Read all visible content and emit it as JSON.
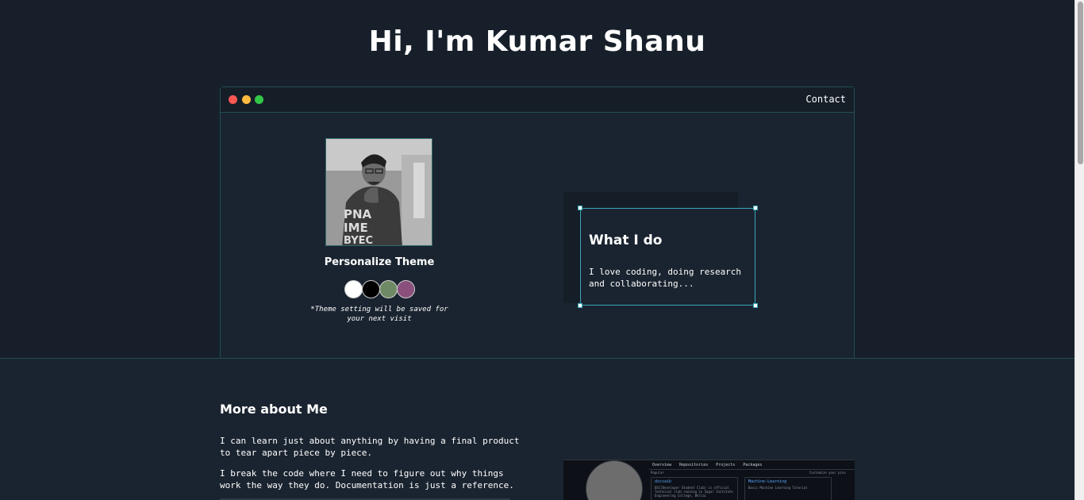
{
  "hero": {
    "title": "Hi, I'm Kumar Shanu"
  },
  "window": {
    "controls": [
      "close",
      "minimize",
      "maximize"
    ],
    "nav": {
      "contact": "Contact"
    }
  },
  "theme": {
    "title": "Personalize Theme",
    "swatches": [
      {
        "name": "light",
        "color": "#ffffff"
      },
      {
        "name": "dark",
        "color": "#000000"
      },
      {
        "name": "green",
        "color": "#6e8a64"
      },
      {
        "name": "purple",
        "color": "#8a4f7d"
      }
    ],
    "note": "*Theme setting will be saved for your next visit"
  },
  "what_i_do": {
    "title": "What I do",
    "text": "I love coding, doing research and collaborating..."
  },
  "about": {
    "title": "More about Me",
    "paragraphs": [
      "I can learn just about anything by having a final product to tear apart piece by piece.",
      "I break the code where I need to figure out why things work the way they do. Documentation is just a reference."
    ]
  },
  "github_preview": {
    "tabs": [
      "Overview",
      "Repositories",
      "Projects",
      "Packages"
    ],
    "label": "Popular",
    "customize": "Customize your pins",
    "repos": [
      {
        "name": "dscsaib",
        "desc": "DSC(Developer Student Club) is official Technical club running in Sagar Institute Engineering College, Bhilai"
      },
      {
        "name": "Machine-Learning",
        "desc": "Basic Machine Learning Tutorial"
      }
    ]
  },
  "colors": {
    "background": "#17202a",
    "panel": "#1a2430",
    "border": "#1f4f55",
    "accent": "#3aa6b9"
  }
}
